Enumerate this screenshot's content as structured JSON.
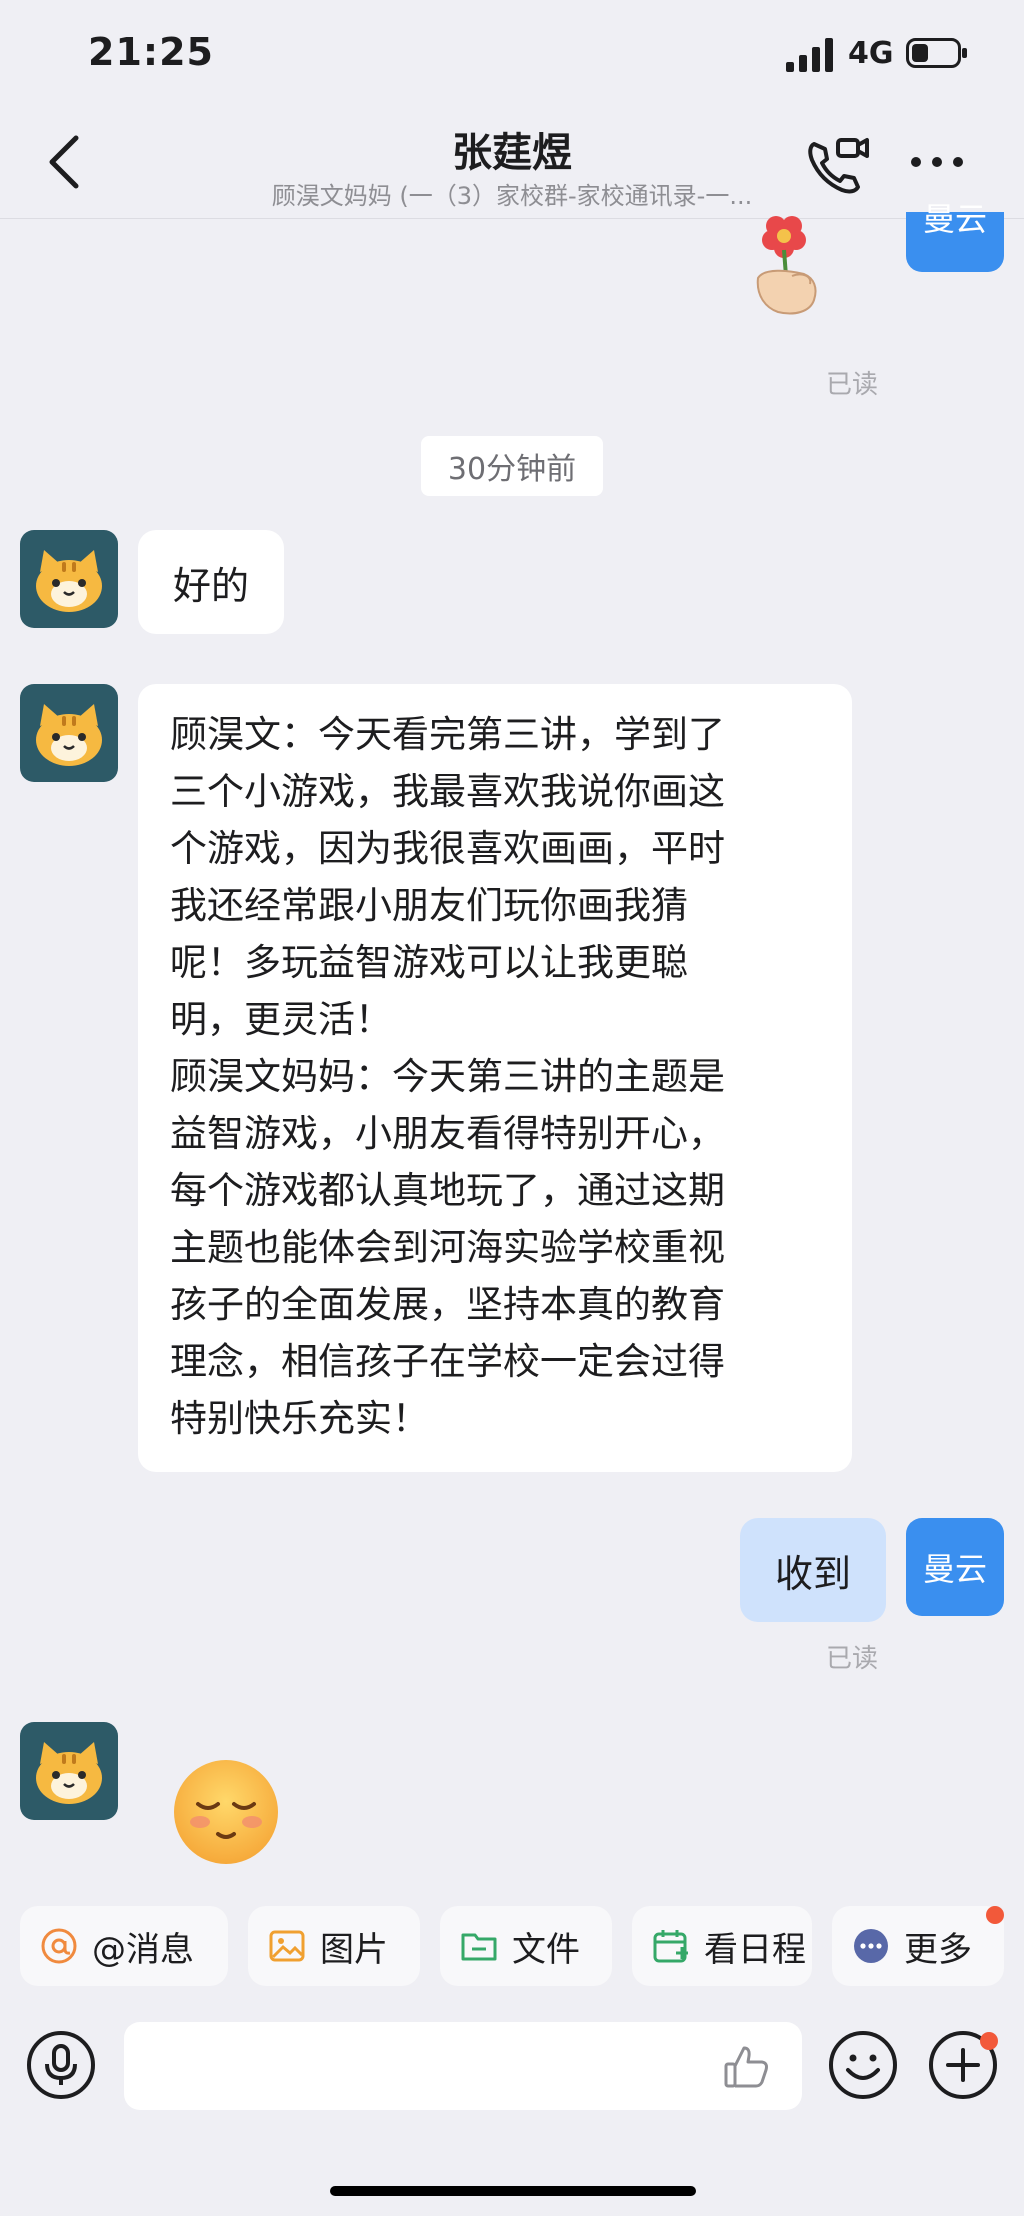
{
  "status_bar": {
    "time": "21:25",
    "network": "4G",
    "icons": [
      "signal-icon",
      "battery-icon"
    ]
  },
  "header": {
    "back_icon": "chevron-left-icon",
    "title": "张莛煜",
    "subtitle": "顾淏文妈妈 (一（3）家校群-家校通讯录-一...",
    "call_icon": "phone-video-icon",
    "more_icon": "more-dots-icon"
  },
  "chat": {
    "me_name": "曼云",
    "timestamp": "30分钟前",
    "read_label_1": "已读",
    "read_label_2": "已读",
    "messages": [
      {
        "side": "left",
        "type": "text",
        "text": "好的"
      },
      {
        "side": "left",
        "type": "text",
        "text": "顾淏文：今天看完第三讲，学到了\n三个小游戏，我最喜欢我说你画这\n个游戏，因为我很喜欢画画，平时\n我还经常跟小朋友们玩你画我猜\n呢！多玩益智游戏可以让我更聪\n明，更灵活！\n顾淏文妈妈：今天第三讲的主题是\n益智游戏，小朋友看得特别开心，\n每个游戏都认真地玩了，通过这期\n主题也能体会到河海实验学校重视\n孩子的全面发展，坚持本真的教育\n理念，相信孩子在学校一定会过得\n特别快乐充实！"
      },
      {
        "side": "right",
        "type": "text",
        "text": "收到"
      },
      {
        "side": "left",
        "type": "sticker",
        "icon": "smiling-face-emoji-icon"
      }
    ],
    "stickers": [
      "flower-hand-sticker-icon",
      "cat-avatar-icon"
    ]
  },
  "quick_actions": [
    {
      "label": "@消息",
      "icon": "at-mention-icon"
    },
    {
      "label": "图片",
      "icon": "image-icon"
    },
    {
      "label": "文件",
      "icon": "folder-icon"
    },
    {
      "label": "看日程",
      "icon": "calendar-add-icon"
    },
    {
      "label": "更多",
      "icon": "more-dots-circle-icon"
    }
  ],
  "input_bar": {
    "voice_icon": "microphone-icon",
    "like_icon": "thumbs-up-icon",
    "emoji_icon": "smiley-icon",
    "plus_icon": "plus-circle-icon"
  },
  "colors": {
    "background": "#efeff4",
    "accent": "#3a8fef",
    "outgoing_bubble": "#cfe2fc",
    "badge": "#f2593a",
    "avatar_bg": "#2d5a67"
  }
}
